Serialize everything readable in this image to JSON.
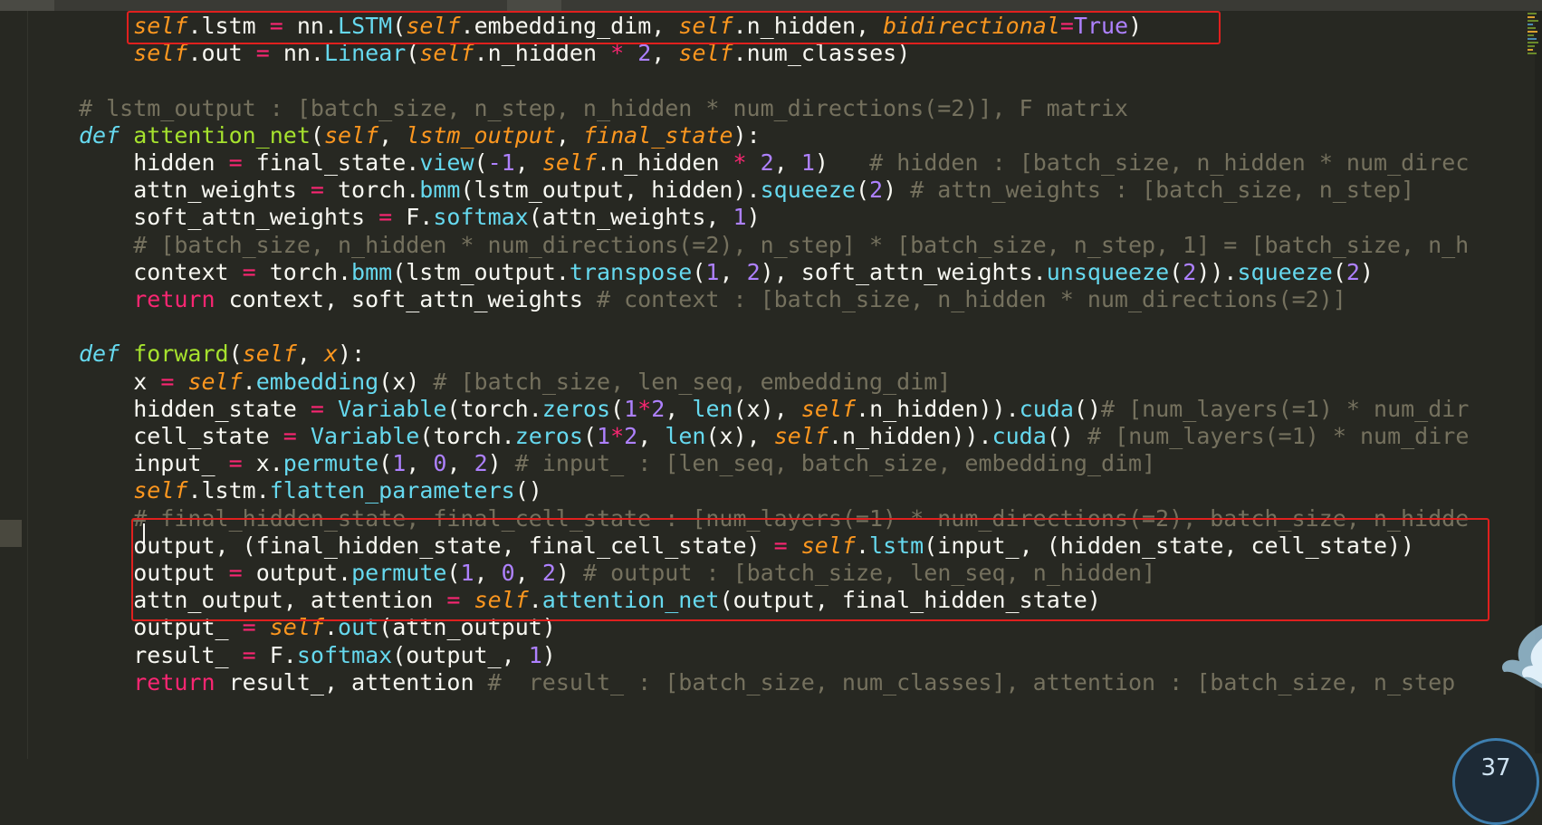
{
  "editor": {
    "lines": [
      [
        [
          "    ",
          "plain"
        ],
        [
          "self",
          "self"
        ],
        [
          ".lstm ",
          "plain"
        ],
        [
          "=",
          "op"
        ],
        [
          " nn.",
          "plain"
        ],
        [
          "LSTM",
          "call"
        ],
        [
          "(",
          "plain"
        ],
        [
          "self",
          "self"
        ],
        [
          ".embedding_dim, ",
          "plain"
        ],
        [
          "self",
          "self"
        ],
        [
          ".n_hidden, ",
          "plain"
        ],
        [
          "bidirectional",
          "param"
        ],
        [
          "=",
          "op"
        ],
        [
          "True",
          "num"
        ],
        [
          ")",
          "plain"
        ]
      ],
      [
        [
          "    ",
          "plain"
        ],
        [
          "self",
          "self"
        ],
        [
          ".out ",
          "plain"
        ],
        [
          "=",
          "op"
        ],
        [
          " nn.",
          "plain"
        ],
        [
          "Linear",
          "call"
        ],
        [
          "(",
          "plain"
        ],
        [
          "self",
          "self"
        ],
        [
          ".n_hidden ",
          "plain"
        ],
        [
          "*",
          "op"
        ],
        [
          " ",
          "plain"
        ],
        [
          "2",
          "num"
        ],
        [
          ", ",
          "plain"
        ],
        [
          "self",
          "self"
        ],
        [
          ".num_classes)",
          "plain"
        ]
      ],
      [],
      [
        [
          "# lstm_output : [batch_size, n_step, n_hidden * num_directions(=2)], F matrix",
          "cmt"
        ]
      ],
      [
        [
          "def",
          "kw"
        ],
        [
          " ",
          "plain"
        ],
        [
          "attention_net",
          "fn"
        ],
        [
          "(",
          "plain"
        ],
        [
          "self",
          "self"
        ],
        [
          ", ",
          "plain"
        ],
        [
          "lstm_output",
          "param"
        ],
        [
          ", ",
          "plain"
        ],
        [
          "final_state",
          "param"
        ],
        [
          "):",
          "plain"
        ]
      ],
      [
        [
          "    hidden ",
          "plain"
        ],
        [
          "=",
          "op"
        ],
        [
          " final_state.",
          "plain"
        ],
        [
          "view",
          "call"
        ],
        [
          "(",
          "plain"
        ],
        [
          "-1",
          "num"
        ],
        [
          ", ",
          "plain"
        ],
        [
          "self",
          "self"
        ],
        [
          ".n_hidden ",
          "plain"
        ],
        [
          "*",
          "op"
        ],
        [
          " ",
          "plain"
        ],
        [
          "2",
          "num"
        ],
        [
          ", ",
          "plain"
        ],
        [
          "1",
          "num"
        ],
        [
          ")   ",
          "plain"
        ],
        [
          "# hidden : [batch_size, n_hidden * num_direc",
          "cmt"
        ]
      ],
      [
        [
          "    attn_weights ",
          "plain"
        ],
        [
          "=",
          "op"
        ],
        [
          " torch.",
          "plain"
        ],
        [
          "bmm",
          "call"
        ],
        [
          "(lstm_output, hidden).",
          "plain"
        ],
        [
          "squeeze",
          "call"
        ],
        [
          "(",
          "plain"
        ],
        [
          "2",
          "num"
        ],
        [
          ") ",
          "plain"
        ],
        [
          "# attn_weights : [batch_size, n_step]",
          "cmt"
        ]
      ],
      [
        [
          "    soft_attn_weights ",
          "plain"
        ],
        [
          "=",
          "op"
        ],
        [
          " F.",
          "plain"
        ],
        [
          "softmax",
          "call"
        ],
        [
          "(attn_weights, ",
          "plain"
        ],
        [
          "1",
          "num"
        ],
        [
          ")",
          "plain"
        ]
      ],
      [
        [
          "    # [batch_size, n_hidden * num_directions(=2), n_step] * [batch_size, n_step, 1] = [batch_size, n_h",
          "cmt"
        ]
      ],
      [
        [
          "    context ",
          "plain"
        ],
        [
          "=",
          "op"
        ],
        [
          " torch.",
          "plain"
        ],
        [
          "bmm",
          "call"
        ],
        [
          "(lstm_output.",
          "plain"
        ],
        [
          "transpose",
          "call"
        ],
        [
          "(",
          "plain"
        ],
        [
          "1",
          "num"
        ],
        [
          ", ",
          "plain"
        ],
        [
          "2",
          "num"
        ],
        [
          "), soft_attn_weights.",
          "plain"
        ],
        [
          "unsqueeze",
          "call"
        ],
        [
          "(",
          "plain"
        ],
        [
          "2",
          "num"
        ],
        [
          ")).",
          "plain"
        ],
        [
          "squeeze",
          "call"
        ],
        [
          "(",
          "plain"
        ],
        [
          "2",
          "num"
        ],
        [
          ")",
          "plain"
        ]
      ],
      [
        [
          "    ",
          "plain"
        ],
        [
          "return",
          "kw2"
        ],
        [
          " context, soft_attn_weights ",
          "plain"
        ],
        [
          "# context : [batch_size, n_hidden * num_directions(=2)]",
          "cmt"
        ]
      ],
      [],
      [
        [
          "def",
          "kw"
        ],
        [
          " ",
          "plain"
        ],
        [
          "forward",
          "fn"
        ],
        [
          "(",
          "plain"
        ],
        [
          "self",
          "self"
        ],
        [
          ", ",
          "plain"
        ],
        [
          "x",
          "param"
        ],
        [
          "):",
          "plain"
        ]
      ],
      [
        [
          "    x ",
          "plain"
        ],
        [
          "=",
          "op"
        ],
        [
          " ",
          "plain"
        ],
        [
          "self",
          "self"
        ],
        [
          ".",
          "plain"
        ],
        [
          "embedding",
          "call"
        ],
        [
          "(x) ",
          "plain"
        ],
        [
          "# [batch_size, len_seq, embedding_dim]",
          "cmt"
        ]
      ],
      [
        [
          "    hidden_state ",
          "plain"
        ],
        [
          "=",
          "op"
        ],
        [
          " ",
          "plain"
        ],
        [
          "Variable",
          "call"
        ],
        [
          "(torch.",
          "plain"
        ],
        [
          "zeros",
          "call"
        ],
        [
          "(",
          "plain"
        ],
        [
          "1",
          "num"
        ],
        [
          "*",
          "op"
        ],
        [
          "2",
          "num"
        ],
        [
          ", ",
          "plain"
        ],
        [
          "len",
          "call"
        ],
        [
          "(x), ",
          "plain"
        ],
        [
          "self",
          "self"
        ],
        [
          ".n_hidden)).",
          "plain"
        ],
        [
          "cuda",
          "call"
        ],
        [
          "()",
          "plain"
        ],
        [
          "# [num_layers(=1) * num_dir",
          "cmt"
        ]
      ],
      [
        [
          "    cell_state ",
          "plain"
        ],
        [
          "=",
          "op"
        ],
        [
          " ",
          "plain"
        ],
        [
          "Variable",
          "call"
        ],
        [
          "(torch.",
          "plain"
        ],
        [
          "zeros",
          "call"
        ],
        [
          "(",
          "plain"
        ],
        [
          "1",
          "num"
        ],
        [
          "*",
          "op"
        ],
        [
          "2",
          "num"
        ],
        [
          ", ",
          "plain"
        ],
        [
          "len",
          "call"
        ],
        [
          "(x), ",
          "plain"
        ],
        [
          "self",
          "self"
        ],
        [
          ".n_hidden)).",
          "plain"
        ],
        [
          "cuda",
          "call"
        ],
        [
          "() ",
          "plain"
        ],
        [
          "# [num_layers(=1) * num_dire",
          "cmt"
        ]
      ],
      [
        [
          "    input_ ",
          "plain"
        ],
        [
          "=",
          "op"
        ],
        [
          " x.",
          "plain"
        ],
        [
          "permute",
          "call"
        ],
        [
          "(",
          "plain"
        ],
        [
          "1",
          "num"
        ],
        [
          ", ",
          "plain"
        ],
        [
          "0",
          "num"
        ],
        [
          ", ",
          "plain"
        ],
        [
          "2",
          "num"
        ],
        [
          ") ",
          "plain"
        ],
        [
          "# input_ : [len_seq, batch_size, embedding_dim]",
          "cmt"
        ]
      ],
      [
        [
          "    ",
          "plain"
        ],
        [
          "self",
          "self"
        ],
        [
          ".lstm.",
          "plain"
        ],
        [
          "flatten_parameters",
          "call"
        ],
        [
          "()",
          "plain"
        ]
      ],
      [
        [
          "    # final_hidden_state, final_cell_state : [num_layers(=1) * num_directions(=2), batch_size, n_hidde",
          "cmt"
        ]
      ],
      [
        [
          "    output, (final_hidden_state, final_cell_state) ",
          "plain"
        ],
        [
          "=",
          "op"
        ],
        [
          " ",
          "plain"
        ],
        [
          "self",
          "self"
        ],
        [
          ".",
          "plain"
        ],
        [
          "lstm",
          "call"
        ],
        [
          "(input_, (hidden_state, cell_state))",
          "plain"
        ]
      ],
      [
        [
          "    output ",
          "plain"
        ],
        [
          "=",
          "op"
        ],
        [
          " output.",
          "plain"
        ],
        [
          "permute",
          "call"
        ],
        [
          "(",
          "plain"
        ],
        [
          "1",
          "num"
        ],
        [
          ", ",
          "plain"
        ],
        [
          "0",
          "num"
        ],
        [
          ", ",
          "plain"
        ],
        [
          "2",
          "num"
        ],
        [
          ") ",
          "plain"
        ],
        [
          "# output : [batch_size, len_seq, n_hidden]",
          "cmt"
        ]
      ],
      [
        [
          "    attn_output, attention ",
          "plain"
        ],
        [
          "=",
          "op"
        ],
        [
          " ",
          "plain"
        ],
        [
          "self",
          "self"
        ],
        [
          ".",
          "plain"
        ],
        [
          "attention_net",
          "call"
        ],
        [
          "(output, final_hidden_state)",
          "plain"
        ]
      ],
      [
        [
          "    output_ ",
          "plain"
        ],
        [
          "=",
          "op"
        ],
        [
          " ",
          "plain"
        ],
        [
          "self",
          "self"
        ],
        [
          ".",
          "plain"
        ],
        [
          "out",
          "call"
        ],
        [
          "(attn_output)",
          "plain"
        ]
      ],
      [
        [
          "    result_ ",
          "plain"
        ],
        [
          "=",
          "op"
        ],
        [
          " F.",
          "plain"
        ],
        [
          "softmax",
          "call"
        ],
        [
          "(output_, ",
          "plain"
        ],
        [
          "1",
          "num"
        ],
        [
          ")",
          "plain"
        ]
      ],
      [
        [
          "    ",
          "plain"
        ],
        [
          "return",
          "kw2"
        ],
        [
          " result_, attention ",
          "plain"
        ],
        [
          "#  result_ : [batch_size, num_classes], attention : [batch_size, n_step",
          "cmt"
        ]
      ]
    ]
  },
  "overlay": {
    "counter_text": "37"
  }
}
